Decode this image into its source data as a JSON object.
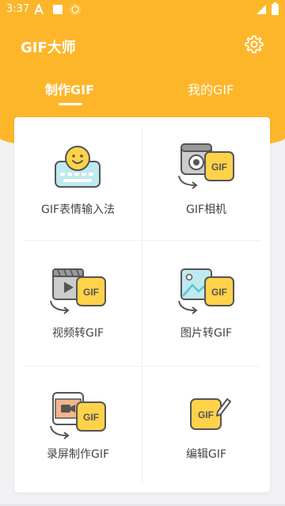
{
  "status": {
    "time": "3:37"
  },
  "app": {
    "title": "GIF大师"
  },
  "tabs": [
    {
      "label": "制作GIF",
      "active": true
    },
    {
      "label": "我的GIF",
      "active": false
    }
  ],
  "features": [
    {
      "label": "GIF表情输入法",
      "icon": "emoji-keyboard-icon"
    },
    {
      "label": "GIF相机",
      "icon": "camera-to-gif-icon"
    },
    {
      "label": "视频转GIF",
      "icon": "video-to-gif-icon"
    },
    {
      "label": "图片转GIF",
      "icon": "image-to-gif-icon"
    },
    {
      "label": "录屏制作GIF",
      "icon": "screen-record-to-gif-icon"
    },
    {
      "label": "编辑GIF",
      "icon": "edit-gif-icon"
    }
  ],
  "badge_text": "GIF",
  "colors": {
    "accent": "#fdb62a",
    "badge": "#ffd24a",
    "outline": "#555555",
    "teal": "#5cc8c8"
  }
}
